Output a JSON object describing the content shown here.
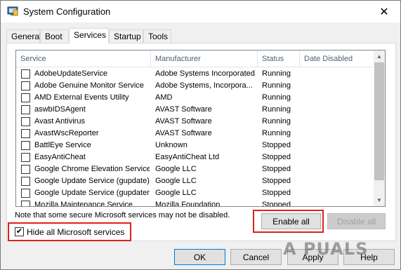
{
  "window": {
    "title": "System Configuration",
    "close_glyph": "✕"
  },
  "tabs": [
    {
      "label": "General",
      "active": false
    },
    {
      "label": "Boot",
      "active": false
    },
    {
      "label": "Services",
      "active": true
    },
    {
      "label": "Startup",
      "active": false
    },
    {
      "label": "Tools",
      "active": false
    }
  ],
  "services_table": {
    "columns": [
      "Service",
      "Manufacturer",
      "Status",
      "Date Disabled"
    ],
    "rows": [
      {
        "service": "AdobeUpdateService",
        "manufacturer": "Adobe Systems Incorporated",
        "status": "Running",
        "date_disabled": ""
      },
      {
        "service": "Adobe Genuine Monitor Service",
        "manufacturer": "Adobe Systems, Incorpora...",
        "status": "Running",
        "date_disabled": ""
      },
      {
        "service": "AMD External Events Utility",
        "manufacturer": "AMD",
        "status": "Running",
        "date_disabled": ""
      },
      {
        "service": "aswbIDSAgent",
        "manufacturer": "AVAST Software",
        "status": "Running",
        "date_disabled": ""
      },
      {
        "service": "Avast Antivirus",
        "manufacturer": "AVAST Software",
        "status": "Running",
        "date_disabled": ""
      },
      {
        "service": "AvastWscReporter",
        "manufacturer": "AVAST Software",
        "status": "Running",
        "date_disabled": ""
      },
      {
        "service": "BattlEye Service",
        "manufacturer": "Unknown",
        "status": "Stopped",
        "date_disabled": ""
      },
      {
        "service": "EasyAntiCheat",
        "manufacturer": "EasyAntiCheat Ltd",
        "status": "Stopped",
        "date_disabled": ""
      },
      {
        "service": "Google Chrome Elevation Service",
        "manufacturer": "Google LLC",
        "status": "Stopped",
        "date_disabled": ""
      },
      {
        "service": "Google Update Service (gupdate)",
        "manufacturer": "Google LLC",
        "status": "Stopped",
        "date_disabled": ""
      },
      {
        "service": "Google Update Service (gupdatem)",
        "manufacturer": "Google LLC",
        "status": "Stopped",
        "date_disabled": ""
      },
      {
        "service": "Mozilla Maintenance Service",
        "manufacturer": "Mozilla Foundation",
        "status": "Stopped",
        "date_disabled": ""
      }
    ]
  },
  "note": "Note that some secure Microsoft services may not be disabled.",
  "hide_microsoft": {
    "label": "Hide all Microsoft services",
    "checked": true,
    "check_glyph": "✔"
  },
  "buttons": {
    "enable_all": "Enable all",
    "disable_all": "Disable all",
    "ok": "OK",
    "cancel": "Cancel",
    "apply": "Apply",
    "help": "Help"
  },
  "watermark": "A PUALS",
  "colors": {
    "highlight_outline": "#e0201c",
    "header_text": "#4c607a",
    "primary_border": "#0078d7"
  }
}
